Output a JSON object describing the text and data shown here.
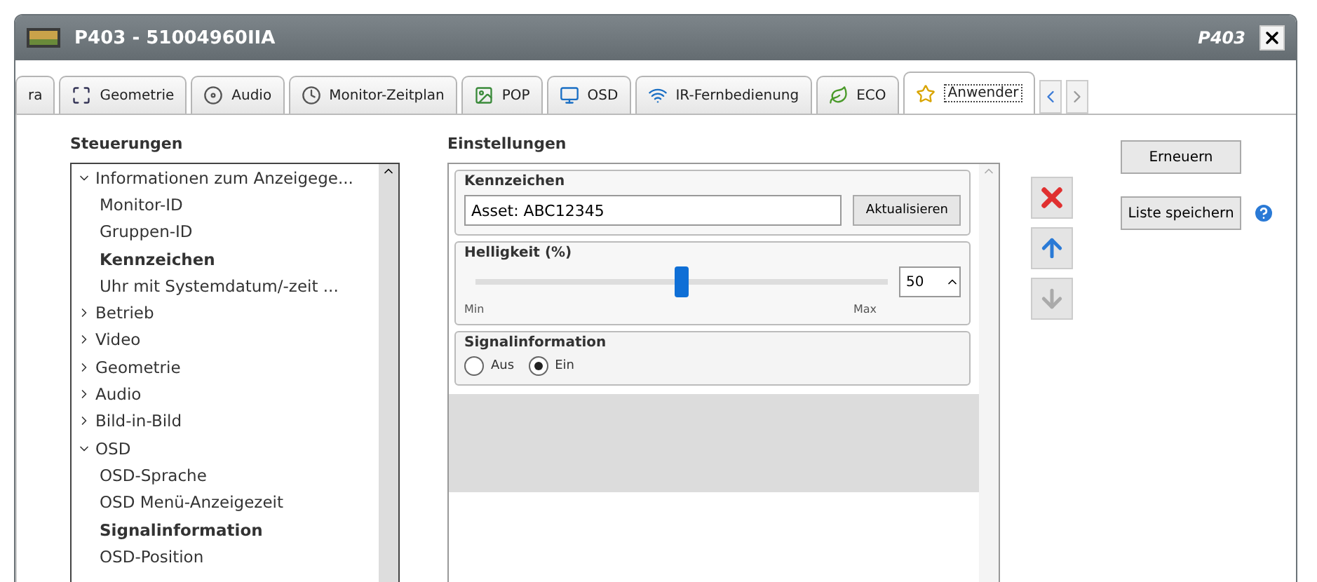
{
  "window": {
    "title": "P403 - 51004960IIA",
    "model": "P403"
  },
  "tabs": [
    {
      "label": "ra",
      "selected": false
    },
    {
      "label": "Geometrie",
      "selected": false
    },
    {
      "label": "Audio",
      "selected": false
    },
    {
      "label": "Monitor-Zeitplan",
      "selected": false
    },
    {
      "label": "POP",
      "selected": false
    },
    {
      "label": "OSD",
      "selected": false
    },
    {
      "label": "IR-Fernbedienung",
      "selected": false
    },
    {
      "label": "ECO",
      "selected": false
    },
    {
      "label": "Anwender",
      "selected": true
    }
  ],
  "controls": {
    "title": "Steuerungen",
    "tree": [
      {
        "label": "Informationen zum Anzeigege...",
        "expanded": true,
        "children": [
          {
            "label": "Monitor-ID",
            "selected": false
          },
          {
            "label": "Gruppen-ID",
            "selected": false
          },
          {
            "label": "Kennzeichen",
            "selected": true
          },
          {
            "label": "Uhr mit Systemdatum/-zeit ...",
            "selected": false
          }
        ]
      },
      {
        "label": "Betrieb",
        "expanded": false
      },
      {
        "label": "Video",
        "expanded": false
      },
      {
        "label": "Geometrie",
        "expanded": false
      },
      {
        "label": "Audio",
        "expanded": false
      },
      {
        "label": "Bild-in-Bild",
        "expanded": false
      },
      {
        "label": "OSD",
        "expanded": true,
        "children": [
          {
            "label": "OSD-Sprache",
            "selected": false
          },
          {
            "label": "OSD Menü-Anzeigezeit",
            "selected": false
          },
          {
            "label": "Signalinformation",
            "selected": true
          },
          {
            "label": "OSD-Position",
            "selected": false
          }
        ]
      }
    ]
  },
  "settings": {
    "title": "Einstellungen",
    "tag": {
      "title": "Kennzeichen",
      "value": "Asset: ABC12345",
      "button": "Aktualisieren"
    },
    "brightness": {
      "title": "Helligkeit (%)",
      "level": 0.5,
      "value": "50",
      "min": "Min",
      "max": "Max"
    },
    "signal": {
      "title": "Signalinformation",
      "options": [
        {
          "label": "Aus",
          "selected": false
        },
        {
          "label": "Ein",
          "selected": true
        }
      ]
    },
    "side_buttons": [
      {
        "kind": "delete",
        "disabled": false
      },
      {
        "kind": "up",
        "disabled": false
      },
      {
        "kind": "down",
        "disabled": true
      }
    ]
  },
  "buttons": [
    "Erneuern",
    "Liste speichern"
  ]
}
